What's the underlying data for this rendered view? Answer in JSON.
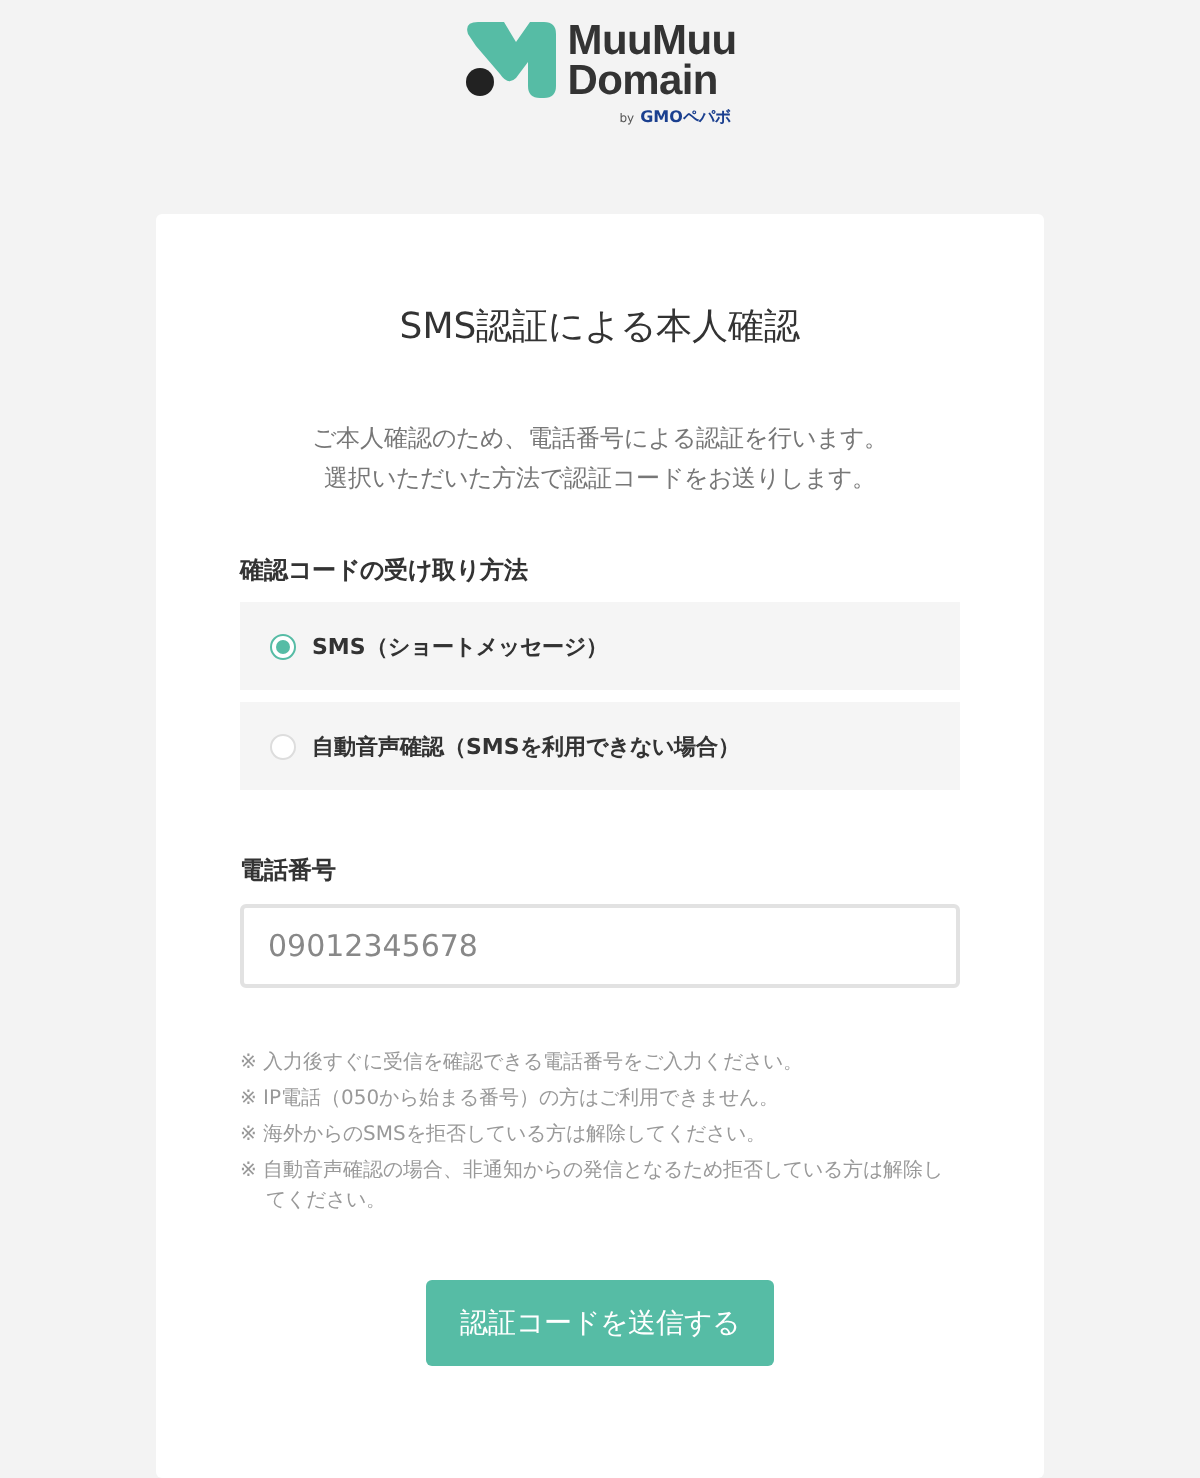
{
  "logo": {
    "line_1": "MuuMuu",
    "line_2": "Domain",
    "byline_prefix": "by",
    "byline_brand": "GMOペパボ"
  },
  "title": "SMS認証による本人確認",
  "intro": [
    "ご本人確認のため、電話番号による認証を行います。",
    "選択いただいた方法で認証コードをお送りします。"
  ],
  "method_label": "確認コードの受け取り方法",
  "methods": [
    {
      "label": "SMS（ショートメッセージ）",
      "selected": true
    },
    {
      "label": "自動音声確認（SMSを利用できない場合）",
      "selected": false
    }
  ],
  "phone": {
    "label": "電話番号",
    "placeholder": "09012345678"
  },
  "notes": [
    "※ 入力後すぐに受信を確認できる電話番号をご入力ください。",
    "※ IP電話（050から始まる番号）の方はご利用できません。",
    "※ 海外からのSMSを拒否している方は解除してください。",
    "※ 自動音声確認の場合、非通知からの発信となるため拒否している方は解除してください。"
  ],
  "submit": "認証コードを送信する"
}
